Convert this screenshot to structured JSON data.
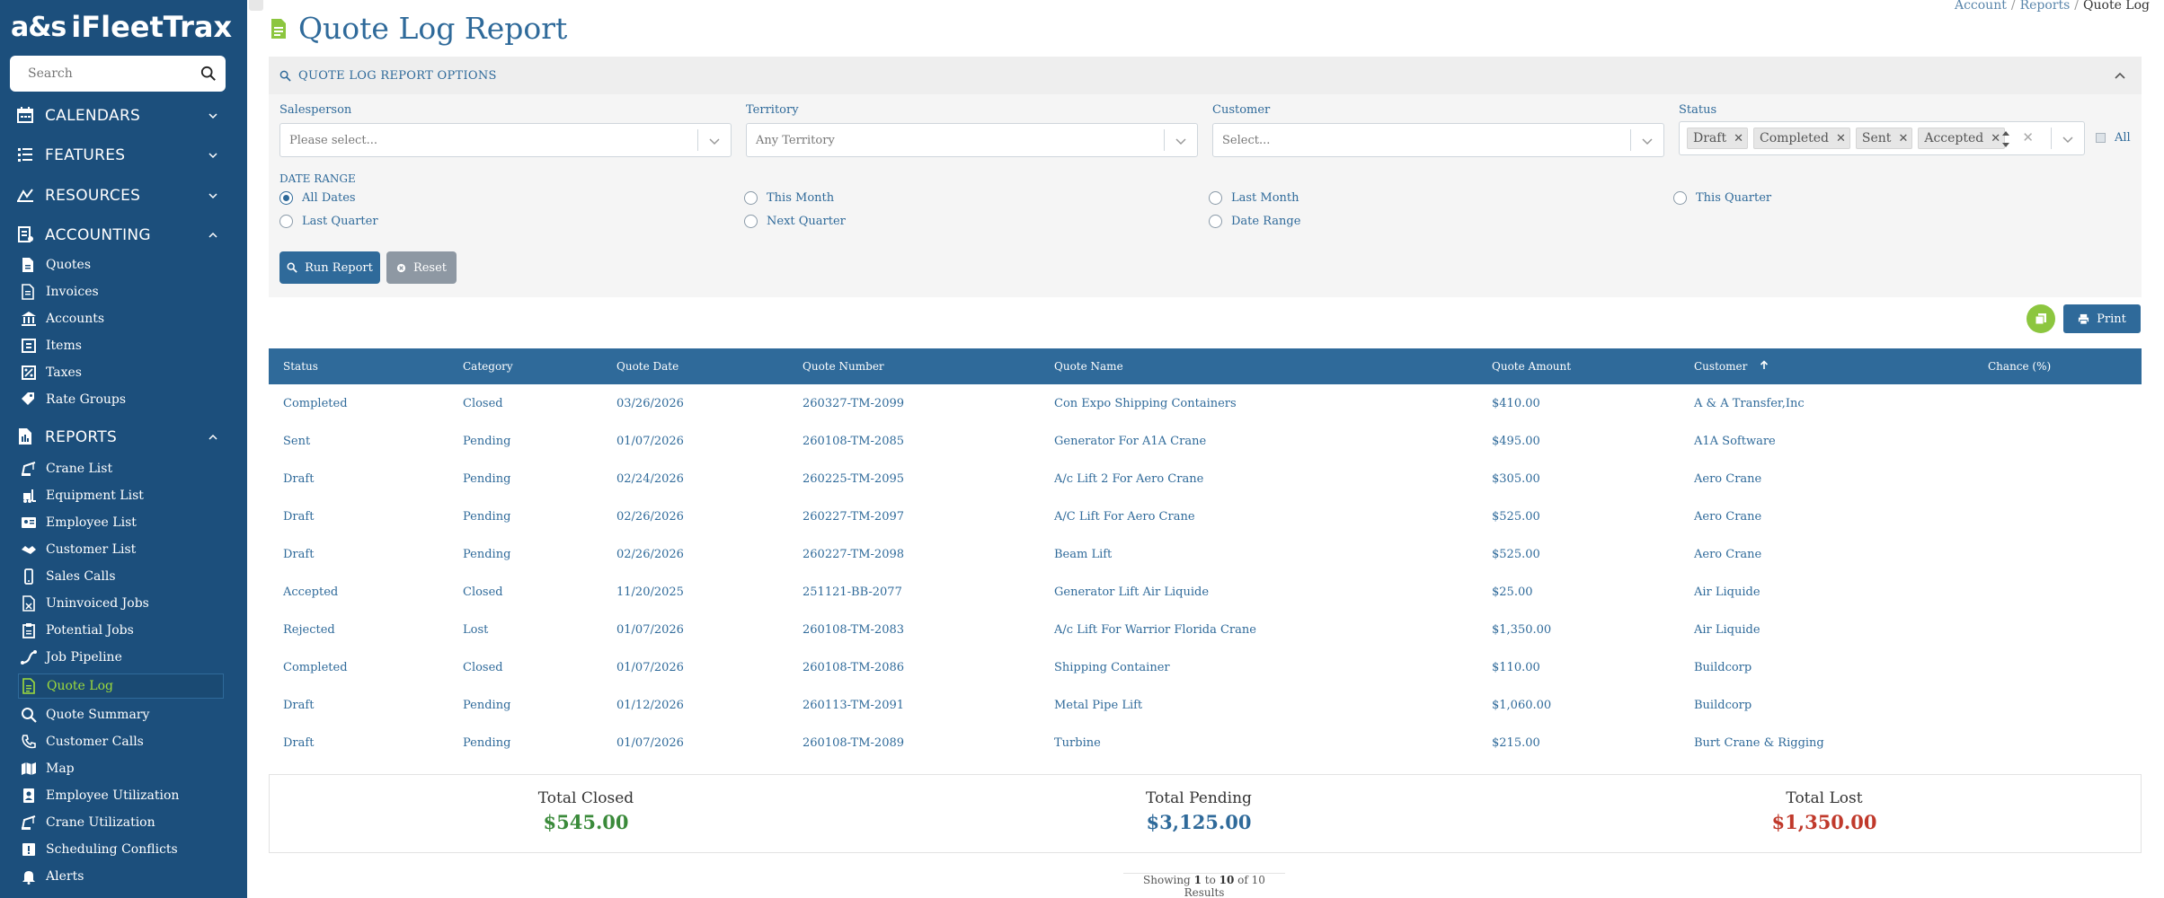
{
  "app": {
    "logo_mark": "a&s",
    "logo_name": "iFleetTrax"
  },
  "search": {
    "placeholder": "Search"
  },
  "sidebar": {
    "sections": [
      {
        "label": "CALENDARS",
        "icon": "calendar-icon",
        "expanded": false
      },
      {
        "label": "FEATURES",
        "icon": "features-icon",
        "expanded": false
      },
      {
        "label": "RESOURCES",
        "icon": "resources-icon",
        "expanded": false
      },
      {
        "label": "ACCOUNTING",
        "icon": "accounting-icon",
        "expanded": true
      },
      {
        "label": "REPORTS",
        "icon": "reports-icon",
        "expanded": true
      }
    ],
    "accounting_items": [
      {
        "label": "Quotes",
        "icon": "quote-file-icon"
      },
      {
        "label": "Invoices",
        "icon": "invoice-icon"
      },
      {
        "label": "Accounts",
        "icon": "bank-icon"
      },
      {
        "label": "Items",
        "icon": "items-icon"
      },
      {
        "label": "Taxes",
        "icon": "tax-icon"
      },
      {
        "label": "Rate Groups",
        "icon": "tags-icon"
      }
    ],
    "report_items": [
      {
        "label": "Crane List",
        "icon": "crane-icon"
      },
      {
        "label": "Equipment List",
        "icon": "forklift-icon"
      },
      {
        "label": "Employee List",
        "icon": "id-card-icon"
      },
      {
        "label": "Customer List",
        "icon": "handshake-icon"
      },
      {
        "label": "Sales Calls",
        "icon": "mobile-icon"
      },
      {
        "label": "Uninvoiced Jobs",
        "icon": "uninvoiced-icon"
      },
      {
        "label": "Potential Jobs",
        "icon": "clipboard-icon"
      },
      {
        "label": "Job Pipeline",
        "icon": "pipeline-icon"
      },
      {
        "label": "Quote Log",
        "icon": "quote-log-icon",
        "active": true
      },
      {
        "label": "Quote Summary",
        "icon": "magnify-icon"
      },
      {
        "label": "Customer Calls",
        "icon": "phone-icon"
      },
      {
        "label": "Map",
        "icon": "map-icon"
      },
      {
        "label": "Employee Utilization",
        "icon": "badge-icon"
      },
      {
        "label": "Crane Utilization",
        "icon": "crane-util-icon"
      },
      {
        "label": "Scheduling Conflicts",
        "icon": "alert-square-icon"
      },
      {
        "label": "Alerts",
        "icon": "bell-icon"
      }
    ]
  },
  "page": {
    "title": "Quote Log Report"
  },
  "breadcrumb": {
    "items": [
      "Account",
      "Reports",
      "Quote Log"
    ]
  },
  "options": {
    "header": "QUOTE LOG REPORT OPTIONS",
    "salesperson": {
      "label": "Salesperson",
      "placeholder": "Please select..."
    },
    "territory": {
      "label": "Territory",
      "placeholder": "Any Territory"
    },
    "customer": {
      "label": "Customer",
      "placeholder": "Select..."
    },
    "status": {
      "label": "Status",
      "tags": [
        "Draft",
        "Completed",
        "Sent",
        "Accepted"
      ],
      "all_label": "All"
    },
    "date_range_label": "DATE RANGE",
    "date_options": [
      {
        "label": "All Dates",
        "selected": true
      },
      {
        "label": "This Month",
        "selected": false
      },
      {
        "label": "Last Month",
        "selected": false
      },
      {
        "label": "This Quarter",
        "selected": false
      },
      {
        "label": "Last Quarter",
        "selected": false
      },
      {
        "label": "Next Quarter",
        "selected": false
      },
      {
        "label": "Date Range",
        "selected": false
      }
    ],
    "run_label": "Run Report",
    "reset_label": "Reset"
  },
  "toolbar": {
    "print_label": "Print"
  },
  "table": {
    "headers": [
      "Status",
      "Category",
      "Quote Date",
      "Quote Number",
      "Quote Name",
      "Quote Amount",
      "Customer",
      "Chance (%)"
    ],
    "sorted_column": "Customer",
    "rows": [
      [
        "Completed",
        "Closed",
        "03/26/2026",
        "260327-TM-2099",
        "Con Expo Shipping Containers",
        "$410.00",
        "A & A Transfer,Inc",
        ""
      ],
      [
        "Sent",
        "Pending",
        "01/07/2026",
        "260108-TM-2085",
        "Generator For A1A Crane",
        "$495.00",
        "A1A Software",
        ""
      ],
      [
        "Draft",
        "Pending",
        "02/24/2026",
        "260225-TM-2095",
        "A/c Lift 2 For Aero Crane",
        "$305.00",
        "Aero Crane",
        ""
      ],
      [
        "Draft",
        "Pending",
        "02/26/2026",
        "260227-TM-2097",
        "A/C Lift For Aero Crane",
        "$525.00",
        "Aero Crane",
        ""
      ],
      [
        "Draft",
        "Pending",
        "02/26/2026",
        "260227-TM-2098",
        "Beam Lift",
        "$525.00",
        "Aero Crane",
        ""
      ],
      [
        "Accepted",
        "Closed",
        "11/20/2025",
        "251121-BB-2077",
        "Generator Lift Air Liquide",
        "$25.00",
        "Air Liquide",
        ""
      ],
      [
        "Rejected",
        "Lost",
        "01/07/2026",
        "260108-TM-2083",
        "A/c Lift For Warrior Florida Crane",
        "$1,350.00",
        "Air Liquide",
        ""
      ],
      [
        "Completed",
        "Closed",
        "01/07/2026",
        "260108-TM-2086",
        "Shipping Container",
        "$110.00",
        "Buildcorp",
        ""
      ],
      [
        "Draft",
        "Pending",
        "01/12/2026",
        "260113-TM-2091",
        "Metal Pipe Lift",
        "$1,060.00",
        "Buildcorp",
        ""
      ],
      [
        "Draft",
        "Pending",
        "01/07/2026",
        "260108-TM-2089",
        "Turbine",
        "$215.00",
        "Burt Crane & Rigging",
        ""
      ]
    ]
  },
  "totals": {
    "closed_label": "Total Closed",
    "closed_value": "$545.00",
    "closed_color": "#3a8a3a",
    "pending_label": "Total Pending",
    "pending_value": "$3,125.00",
    "pending_color": "#2f6a9a",
    "lost_label": "Total Lost",
    "lost_value": "$1,350.00",
    "lost_color": "#c0392b"
  },
  "pagination": {
    "prefix": "Showing",
    "from": "1",
    "to_word": "to",
    "to": "10",
    "of_word": "of",
    "total": "10",
    "suffix": "Results"
  },
  "colors": {
    "sidebar": "#1c4f7c",
    "accent": "#2f6a9a",
    "active": "#9fdc3b"
  }
}
